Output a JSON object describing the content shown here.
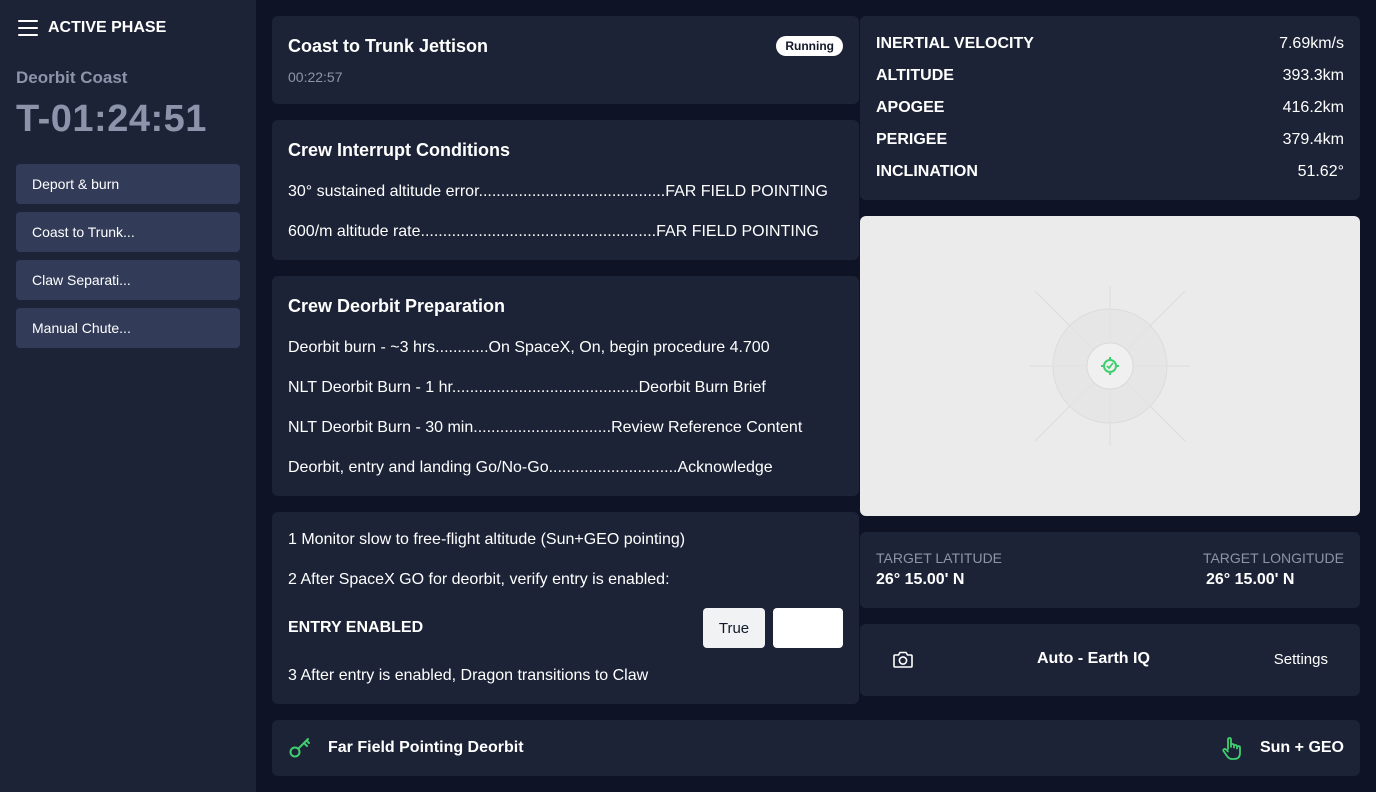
{
  "sidebar": {
    "title": "ACTIVE PHASE",
    "phase_name": "Deorbit Coast",
    "countdown": "T-01:24:51",
    "items": [
      {
        "label": "Deport & burn"
      },
      {
        "label": "Coast to Trunk..."
      },
      {
        "label": "Claw Separati..."
      },
      {
        "label": "Manual Chute..."
      }
    ]
  },
  "header": {
    "title": "Coast to Trunk Jettison",
    "elapsed": "00:22:57",
    "status": "Running"
  },
  "interrupt": {
    "title": "Crew Interrupt Conditions",
    "lines": [
      "30° sustained altitude error..........................................FAR FIELD POINTING",
      "600/m altitude rate.....................................................FAR FIELD POINTING"
    ]
  },
  "prep": {
    "title": "Crew Deorbit Preparation",
    "lines": [
      "Deorbit burn - ~3 hrs............On SpaceX, On, begin procedure 4.700",
      "NLT Deorbit Burn - 1 hr..........................................Deorbit Burn Brief",
      "NLT Deorbit Burn - 30 min...............................Review Reference Content",
      "Deorbit, entry and landing Go/No-Go.............................Acknowledge"
    ]
  },
  "steps": {
    "step1": "1 Monitor slow to free-flight altitude (Sun+GEO pointing)",
    "step2": "2 After SpaceX GO for deorbit, verify entry is enabled:",
    "entry_label": "ENTRY ENABLED",
    "true_label": "True",
    "step3": "3 After entry is enabled, Dragon transitions to Claw"
  },
  "telemetry": [
    {
      "label": "INERTIAL VELOCITY",
      "value": "7.69km/s"
    },
    {
      "label": "ALTITUDE",
      "value": "393.3km"
    },
    {
      "label": "APOGEE",
      "value": "416.2km"
    },
    {
      "label": "PERIGEE",
      "value": "379.4km"
    },
    {
      "label": "INCLINATION",
      "value": "51.62°"
    }
  ],
  "target": {
    "lat_label": "TARGET LATITUDE",
    "lat_value": "26° 15.00' N",
    "lon_label": "TARGET LONGITUDE",
    "lon_value": "26° 15.00' N"
  },
  "camera": {
    "mode": "Auto - Earth IQ",
    "settings": "Settings",
    "icon": "camera-icon"
  },
  "footer": {
    "left_label": "Far Field Pointing Deorbit",
    "left_icon": "key-icon",
    "right_label": "Sun + GEO",
    "right_icon": "hand-pointer-icon"
  },
  "colors": {
    "background": "#0e1426",
    "panel": "#1c2336",
    "nav_item": "#323c58",
    "muted_text": "#8c94ab",
    "accent_green": "#3ecf6e",
    "map_background": "#ebebeb"
  }
}
